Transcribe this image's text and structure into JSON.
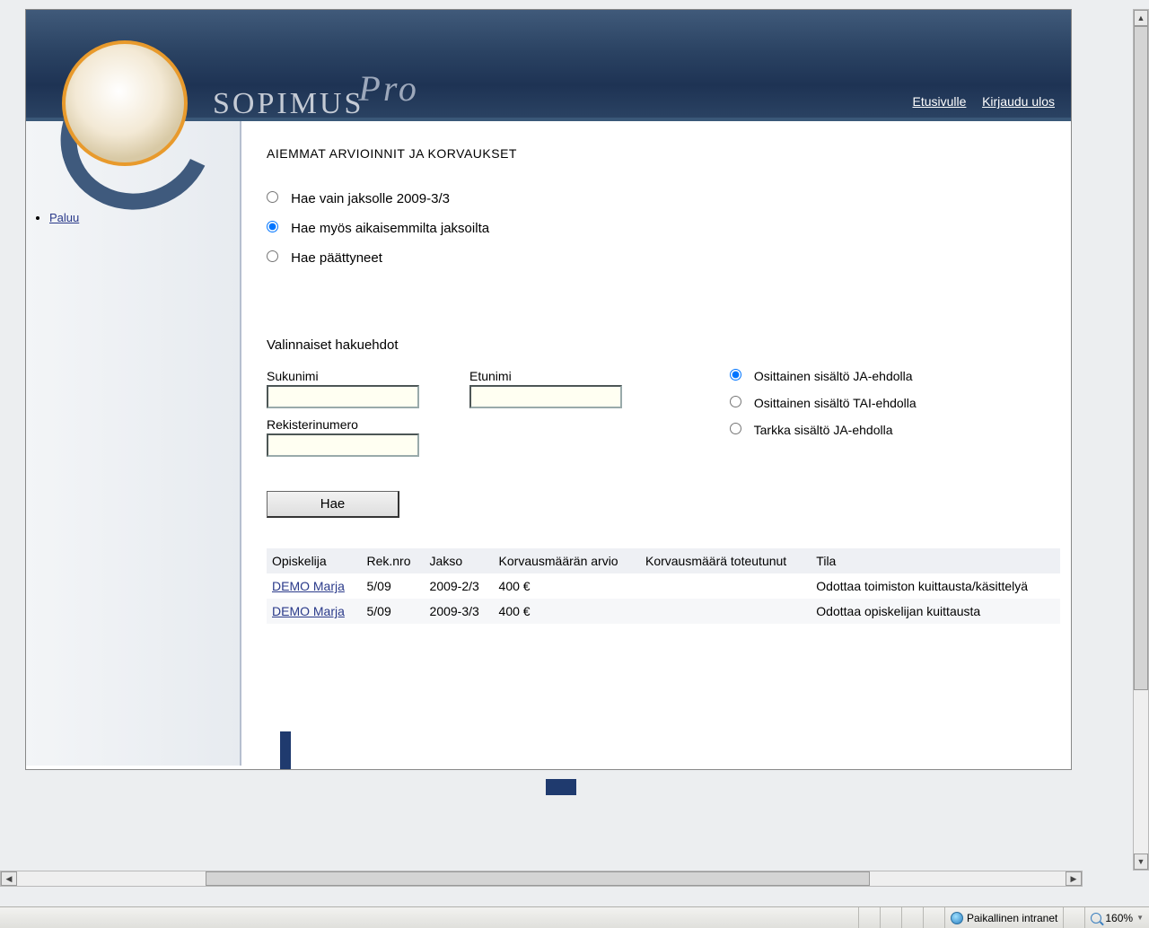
{
  "header": {
    "logo_main": "SOPIMUS",
    "logo_sub": "Pro",
    "links": {
      "home": "Etusivulle",
      "logout": "Kirjaudu ulos"
    }
  },
  "sidebar": {
    "back": "Paluu"
  },
  "main": {
    "title": "AIEMMAT ARVIOINNIT JA KORVAUKSET",
    "period_radios": {
      "opt1": "Hae vain jaksolle 2009-3/3",
      "opt2": "Hae myös aikaisemmilta jaksoilta",
      "opt3": "Hae päättyneet"
    },
    "optional_heading": "Valinnaiset hakuehdot",
    "fields": {
      "lastname_label": "Sukunimi",
      "firstname_label": "Etunimi",
      "regnum_label": "Rekisterinumero",
      "lastname_value": "",
      "firstname_value": "",
      "regnum_value": ""
    },
    "match_radios": {
      "opt1": "Osittainen sisältö JA-ehdolla",
      "opt2": "Osittainen sisältö TAI-ehdolla",
      "opt3": "Tarkka sisältö JA-ehdolla"
    },
    "search_button": "Hae",
    "table": {
      "headers": {
        "student": "Opiskelija",
        "regno": "Rek.nro",
        "period": "Jakso",
        "est": "Korvausmäärän arvio",
        "actual": "Korvausmäärä toteutunut",
        "status": "Tila"
      },
      "rows": [
        {
          "student": "DEMO Marja",
          "regno": "5/09",
          "period": "2009-2/3",
          "est": "400 €",
          "actual": "",
          "status": "Odottaa toimiston kuittausta/käsittelyä"
        },
        {
          "student": "DEMO Marja",
          "regno": "5/09",
          "period": "2009-3/3",
          "est": "400 €",
          "actual": "",
          "status": "Odottaa opiskelijan kuittausta"
        }
      ]
    }
  },
  "statusbar": {
    "zone": "Paikallinen intranet",
    "zoom": "160%"
  }
}
